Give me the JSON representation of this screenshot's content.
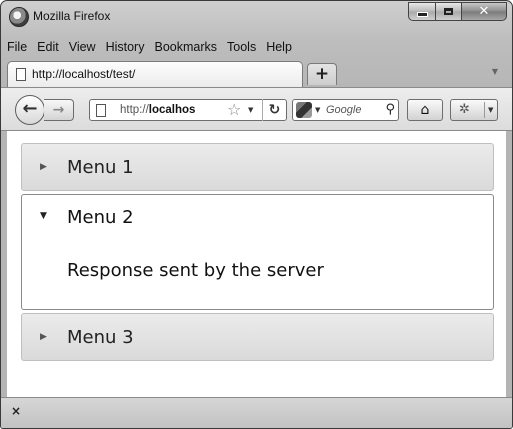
{
  "window": {
    "title": "Mozilla Firefox"
  },
  "menubar": [
    "File",
    "Edit",
    "View",
    "History",
    "Bookmarks",
    "Tools",
    "Help"
  ],
  "tab": {
    "title": "http://localhost/test/",
    "new_tab_label": "+"
  },
  "navbar": {
    "url_prefix": "http://",
    "url_host": "localhos",
    "search_placeholder": "Google"
  },
  "accordion": {
    "sections": [
      {
        "label": "Menu 1",
        "expanded": false
      },
      {
        "label": "Menu 2",
        "expanded": true,
        "content": "Response sent by the server"
      },
      {
        "label": "Menu 3",
        "expanded": false
      }
    ]
  },
  "statusbar": {
    "close_label": "×"
  }
}
